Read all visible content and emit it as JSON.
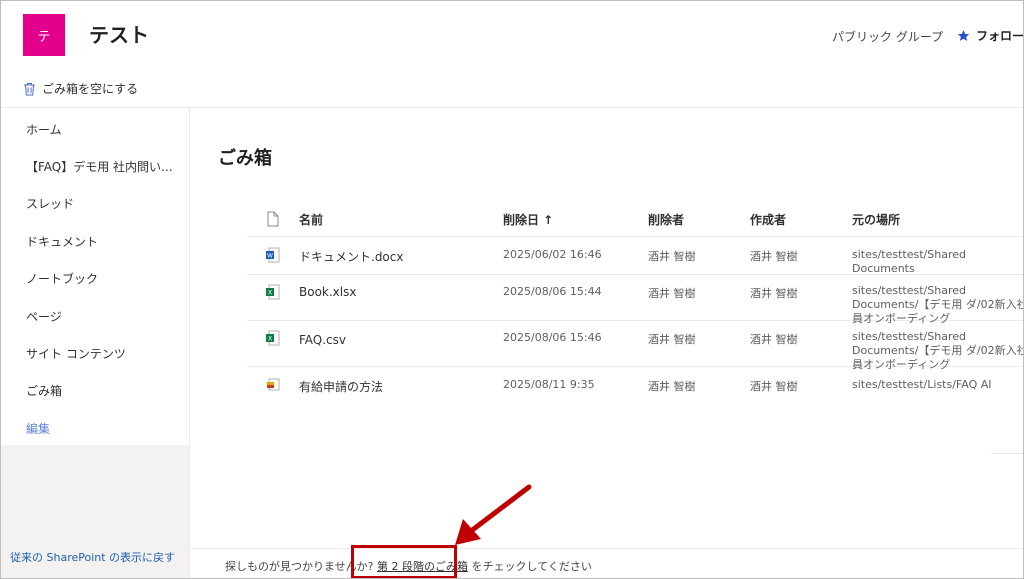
{
  "header": {
    "logo_letter": "テ",
    "site_title": "テスト",
    "group_label": "パブリック グループ",
    "follow_label": "フォロー"
  },
  "commandbar": {
    "empty_recycle_label": "ごみ箱を空にする"
  },
  "nav": {
    "items": [
      {
        "label": "ホーム"
      },
      {
        "label": "【FAQ】デモ用 社内問い..."
      },
      {
        "label": "スレッド"
      },
      {
        "label": "ドキュメント"
      },
      {
        "label": "ノートブック"
      },
      {
        "label": "ページ"
      },
      {
        "label": "サイト コンテンツ"
      },
      {
        "label": "ごみ箱"
      }
    ],
    "edit_label": "編集",
    "classic_link": "従来の SharePoint の表示に戻す"
  },
  "main": {
    "title": "ごみ箱",
    "columns": {
      "name": "名前",
      "deleted_date": "削除日 ↑",
      "deleted_by": "削除者",
      "created_by": "作成者",
      "location": "元の場所"
    },
    "rows": [
      {
        "icon": "word-doc-icon",
        "name": "ドキュメント.docx",
        "deleted": "2025/06/02 16:46",
        "deleted_by": "酒井 智樹",
        "created_by": "酒井 智樹",
        "location": "sites/testtest/Shared Documents"
      },
      {
        "icon": "excel-file-icon",
        "name": "Book.xlsx",
        "deleted": "2025/08/06 15:44",
        "deleted_by": "酒井 智樹",
        "created_by": "酒井 智樹",
        "location": "sites/testtest/Shared Documents/【デモ用 ダ/02新入社員オンボーディング"
      },
      {
        "icon": "csv-file-icon",
        "name": "FAQ.csv",
        "deleted": "2025/08/06 15:46",
        "deleted_by": "酒井 智樹",
        "created_by": "酒井 智樹",
        "location": "sites/testtest/Shared Documents/【デモ用 ダ/02新入社員オンボーディング"
      },
      {
        "icon": "list-item-icon",
        "name": "有給申請の方法",
        "deleted": "2025/08/11 9:35",
        "deleted_by": "酒井 智樹",
        "created_by": "酒井 智樹",
        "location": "sites/testtest/Lists/FAQ AI"
      }
    ]
  },
  "footer": {
    "prefix": "探しものが見つかりませんか? ",
    "link": "第 2 段階のごみ箱",
    "suffix": " をチェックしてください"
  },
  "colors": {
    "logo": "#e3008c",
    "annotation": "#c00000",
    "follow_star": "#2b4fcf",
    "edit_link": "#5b7fd6"
  }
}
